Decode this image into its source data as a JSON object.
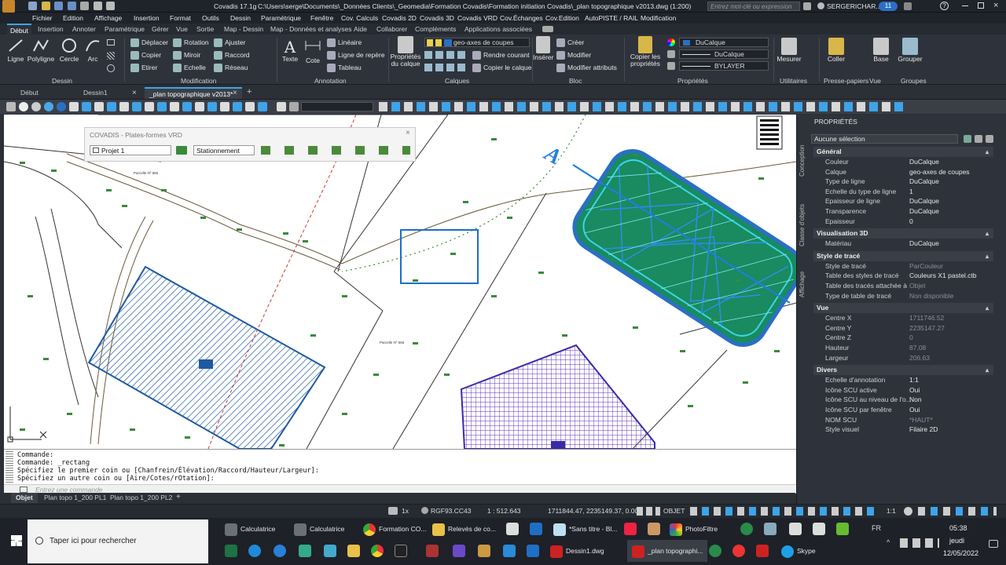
{
  "titlebar": {
    "app": "Covadis 17.1g",
    "path": "C:\\Users\\serge\\Documents\\_Données Clients\\_Geomedia\\Formation Covadis\\Formation initiation Covadis\\_plan topographique v2013.dwg (1:200)",
    "search_placeholder": "Entrez mot-clé ou expression",
    "user": "SERGERICHAR...",
    "notif_count": "11"
  },
  "menu": [
    "Fichier",
    "Edition",
    "Affichage",
    "Insertion",
    "Format",
    "Outils",
    "Dessin",
    "Paramétrique",
    "Fenêtre",
    "Cov. Calculs",
    "Covadis 2D",
    "Covadis 3D",
    "Covadis VRD",
    "Cov.Échanges",
    "Cov.Edition",
    "AutoPISTE / RAIL",
    "Modification"
  ],
  "ribbon_tabs": [
    "Début",
    "Insertion",
    "Annoter",
    "Paramétrique",
    "Gérer",
    "Vue",
    "Sortie",
    "Map - Dessin",
    "Map - Données et analyses",
    "Aide",
    "Collaborer",
    "Compléments",
    "Applications associées"
  ],
  "ribbon": {
    "dessin": {
      "label": "Dessin",
      "ligne": "Ligne",
      "polyligne": "Polyligne",
      "cercle": "Cercle",
      "arc": "Arc"
    },
    "modification": {
      "label": "Modification",
      "deplacer": "Déplacer",
      "rotation": "Rotation",
      "ajuster": "Ajuster",
      "copier": "Copier",
      "miroir": "Miroir",
      "raccord": "Raccord",
      "etirer": "Etirer",
      "echelle": "Echelle",
      "reseau": "Réseau"
    },
    "annotation": {
      "label": "Annotation",
      "texte": "Texte",
      "cote": "Cote",
      "lineaire": "Linéaire",
      "ligne_repere": "Ligne de repère",
      "tableau": "Tableau"
    },
    "calques": {
      "label": "Calques",
      "proprietes": "Propriétés du calque",
      "calque_courant": "geo-axes de coupes",
      "rendre_courant": "Rendre courant",
      "copier_calque": "Copier le calque"
    },
    "bloc": {
      "label": "Bloc",
      "inserer": "Insérer",
      "creer": "Créer",
      "modifier": "Modifier",
      "modifier_attributs": "Modifier attributs"
    },
    "proprietes": {
      "label": "Propriétés",
      "copier_proprietes": "Copier les propriétés",
      "couleur": "DuCalque",
      "type_ligne": "DuCalque",
      "epaisseur": "BYLAYER"
    },
    "utilitaires": {
      "label": "Utilitaires",
      "mesurer": "Mesurer"
    },
    "presse_papiers": {
      "label": "Presse-papiers",
      "coller": "Coller"
    },
    "vue": {
      "label": "Vue",
      "base": "Base"
    },
    "groupes": {
      "label": "Groupes",
      "grouper": "Grouper"
    }
  },
  "doc_tabs": [
    "Début",
    "Dessin1",
    "_plan topographique v2013*"
  ],
  "covadis_panel": {
    "title": "COVADIS - Plates-formes VRD",
    "projet": "Projet 1",
    "mode": "Stationnement"
  },
  "canvas_labels": {
    "a_letter": "A",
    "parcelle1": "Parcelle Nº 566",
    "parcelle2": "Parcelle Nº 565"
  },
  "command": {
    "lines": [
      "Commande:",
      "Commande: _rectang",
      "Spécifiez le premier coin ou [Chanfrein/Élévation/Raccord/Hauteur/Largeur]:",
      "Spécifiez un autre coin ou [Aire/Cotes/rOtation]:"
    ],
    "placeholder": "Entrez une commande"
  },
  "layout_tabs": [
    "Objet",
    "Plan topo 1_200 PL1",
    "Plan topo 1_200 PL2"
  ],
  "properties": {
    "title": "PROPRIÉTÉS",
    "selection": "Aucune sélection",
    "side_tabs": [
      "Conception",
      "Classe d'objets",
      "Affichage"
    ],
    "sections": [
      {
        "name": "Général",
        "rows": [
          [
            "Couleur",
            "DuCalque"
          ],
          [
            "Calque",
            "geo-axes de coupes"
          ],
          [
            "Type de ligne",
            "DuCalque"
          ],
          [
            "Echelle du type de ligne",
            "1"
          ],
          [
            "Epaisseur de ligne",
            "DuCalque"
          ],
          [
            "Transparence",
            "DuCalque"
          ],
          [
            "Epaisseur",
            "0"
          ]
        ]
      },
      {
        "name": "Visualisation 3D",
        "rows": [
          [
            "Matériau",
            "DuCalque"
          ]
        ]
      },
      {
        "name": "Style de tracé",
        "rows": [
          [
            "Style de tracé",
            "ParCouleur"
          ],
          [
            "Table des styles de tracé",
            "Couleurs X1 pastel.ctb"
          ],
          [
            "Table des tracés attachée à",
            "Objet"
          ],
          [
            "Type de table de tracé",
            "Non disponible"
          ]
        ]
      },
      {
        "name": "Vue",
        "rows": [
          [
            "Centre X",
            "1711746.52"
          ],
          [
            "Centre Y",
            "2235147.27"
          ],
          [
            "Centre Z",
            "0"
          ],
          [
            "Hauteur",
            "87.08"
          ],
          [
            "Largeur",
            "206.63"
          ]
        ]
      },
      {
        "name": "Divers",
        "rows": [
          [
            "Echelle d'annotation",
            "1:1"
          ],
          [
            "Icône SCU active",
            "Oui"
          ],
          [
            "Icône SCU au niveau de l'o...",
            "Non"
          ],
          [
            "Icône SCU par fenêtre",
            "Oui"
          ],
          [
            "NOM SCU",
            "*HAUT*"
          ],
          [
            "Style visuel",
            "Filaire 2D"
          ]
        ]
      }
    ]
  },
  "status": {
    "coords": "1711844.47, 2235149.37, 0.00",
    "scale_x": "1x",
    "crs": "RGF93.CC43",
    "ratio": "1 : 512.643",
    "objet": "OBJET",
    "annot": "1:1"
  },
  "taskbar": {
    "search": "Taper ici pour rechercher",
    "top": [
      "Calculatrice",
      "Calculatrice",
      "Formation CO...",
      "Relevés de co...",
      "",
      "",
      "*Sans titre - Bl...",
      "",
      "PhotoFiltre"
    ],
    "bottom": [
      "Dessin1.dwg",
      "_plan topographi...",
      "Skype"
    ],
    "lang": "FR",
    "time": "05:38",
    "day": "jeudi",
    "date": "12/05/2022"
  },
  "colors": {
    "accent": "#3fa3e8",
    "hatch_blue": "#1e5aa0",
    "hatch_purple": "#5a2dbb",
    "surface_green": "#1a8a60"
  }
}
